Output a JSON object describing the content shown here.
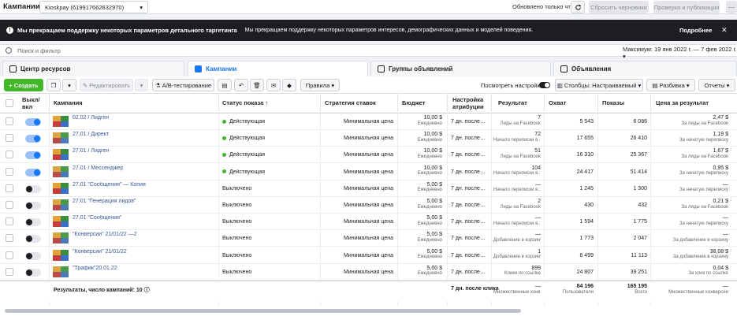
{
  "topbar": {
    "title": "Кампании",
    "account": "Kioskpay (619917662632970)",
    "updated": "Обновлено только что",
    "discard_label": "Сбросить черновики",
    "review_label": "Проверка и публикация"
  },
  "notice": {
    "title": "Мы прекращаем поддержку некоторых параметров детального таргетинга",
    "text": "Мы прекращаем поддержку некоторых параметров интересов, демографических данных и моделей поведения.",
    "more": "Подробнее"
  },
  "search": {
    "placeholder": "Поиск и фильтр",
    "daterange": "Максимум: 19 янв 2022 г. — 7 фев 2022 г."
  },
  "tabs": [
    "Центр ресурсов",
    "Кампании",
    "Группы объявлений",
    "Объявления"
  ],
  "toolbar": {
    "create": "+ Создать",
    "edit": "Редактировать",
    "ab": "A/B-тестирование",
    "rules": "Правила",
    "view_settings": "Посмотреть настройки",
    "columns": "Столбцы: Настраиваемый",
    "breakdown": "Разбивка",
    "reports": "Отчеты"
  },
  "headers": {
    "onoff": "Выкл/\nвкл",
    "campaign": "Кампания",
    "status": "Статус показа ↑",
    "strategy": "Стратегия ставок",
    "budget": "Бюджет",
    "attribution": "Настройка атрибуции",
    "result": "Результат",
    "reach": "Охват",
    "impressions": "Показы",
    "cpr": "Цена за результат"
  },
  "rows": [
    {
      "on": true,
      "name": "02.02 / Лидген",
      "status": "Действующая",
      "active": true,
      "strategy": "Минимальная цена",
      "budget": "10,00 $",
      "budget_sub": "Ежедневно",
      "attr": "7 дн. после клика",
      "result": "7",
      "result_sub": "Лиды на Facebook",
      "reach": "5 543",
      "impr": "6 086",
      "cpr": "2,47 $",
      "cpr_sub": "За лиды на Facebook"
    },
    {
      "on": true,
      "name": "27.01 / Директ",
      "status": "Действующая",
      "active": true,
      "strategy": "Минимальная цена",
      "budget": "10,00 $",
      "budget_sub": "Ежедневно",
      "attr": "7 дн. после клика",
      "result": "72",
      "result_sub": "Начало переписки в...",
      "reach": "17 655",
      "impr": "26 410",
      "cpr": "1,19 $",
      "cpr_sub": "За начатую переписку"
    },
    {
      "on": true,
      "name": "27.01 / Лидген",
      "status": "Действующая",
      "active": true,
      "strategy": "Минимальная цена",
      "budget": "10,00 $",
      "budget_sub": "Ежедневно",
      "attr": "7 дн. после клика",
      "result": "51",
      "result_sub": "Лиды на Facebook",
      "reach": "16 310",
      "impr": "25 367",
      "cpr": "1,67 $",
      "cpr_sub": "За лиды на Facebook"
    },
    {
      "on": true,
      "name": "27.01 / Мессенджер",
      "status": "Действующая",
      "active": true,
      "strategy": "Минимальная цена",
      "budget": "10,00 $",
      "budget_sub": "Ежедневно",
      "attr": "7 дн. после клика",
      "result": "104",
      "result_sub": "Начало переписки в...",
      "reach": "24 417",
      "impr": "51 414",
      "cpr": "0,95 $",
      "cpr_sub": "За начатую переписку"
    },
    {
      "on": false,
      "name": "27.01 \"Сообщения\" — Копия",
      "status": "Выключено",
      "active": false,
      "strategy": "Минимальная цена",
      "budget": "5,00 $",
      "budget_sub": "Ежедневно",
      "attr": "7 дн. после клика",
      "result": "—",
      "result_sub": "Начало переписки в...",
      "reach": "1 245",
      "impr": "1 300",
      "cpr": "—",
      "cpr_sub": "За начатую переписку"
    },
    {
      "on": false,
      "name": "27.01 \"Генерация лидов\"",
      "status": "Выключено",
      "active": false,
      "strategy": "Минимальная цена",
      "budget": "5,00 $",
      "budget_sub": "Ежедневно",
      "attr": "7 дн. после клика",
      "result": "2",
      "result_sub": "Лиды на Facebook",
      "reach": "430",
      "impr": "432",
      "cpr": "0,21 $",
      "cpr_sub": "За лиды на Facebook"
    },
    {
      "on": false,
      "name": "27.01 \"Сообщения\"",
      "status": "Выключено",
      "active": false,
      "strategy": "Минимальная цена",
      "budget": "5,00 $",
      "budget_sub": "Ежедневно",
      "attr": "7 дн. после клика",
      "result": "—",
      "result_sub": "Начало переписки в...",
      "reach": "1 594",
      "impr": "1 775",
      "cpr": "—",
      "cpr_sub": "За начатую переписку"
    },
    {
      "on": false,
      "name": "\"Конверсии\" 21/01/22 —2",
      "status": "Выключено",
      "active": false,
      "strategy": "Минимальная цена",
      "budget": "5,00 $",
      "budget_sub": "Ежедневно",
      "attr": "7 дн. после клика",
      "result": "—",
      "result_sub": "Добавление в корзину",
      "reach": "1 773",
      "impr": "2 047",
      "cpr": "—",
      "cpr_sub": "За добавление в корзину"
    },
    {
      "on": false,
      "name": "\"Конверсии\" 21/01/22",
      "status": "Выключено",
      "active": false,
      "strategy": "Минимальная цена",
      "budget": "5,00 $",
      "budget_sub": "Ежедневно",
      "attr": "7 дн. после клика",
      "result": "1",
      "result_sub": "Добавление в корзину",
      "reach": "6 499",
      "impr": "11 113",
      "cpr": "38,08 $",
      "cpr_sub": "За добавление в корзину"
    },
    {
      "on": false,
      "name": "\"Трафик\"20.01.22",
      "status": "Выключено",
      "active": false,
      "strategy": "Минимальная цена",
      "budget": "5,00 $",
      "budget_sub": "Ежедневно",
      "attr": "7 дн. после клика",
      "result": "899",
      "result_sub": "Клики по ссылке",
      "reach": "24 807",
      "impr": "39 251",
      "cpr": "0,04 $",
      "cpr_sub": "За клик по ссылке"
    }
  ],
  "totals": {
    "label": "Результаты, число кампаний: 10",
    "attr": "7 дн. после клика",
    "result": "—",
    "result_sub": "Множественные конв...",
    "reach": "84 196",
    "reach_sub": "Пользователи",
    "impr": "165 195",
    "impr_sub": "Всего",
    "cpr": "—",
    "cpr_sub": "Множественные конверсии"
  },
  "colors": {
    "accent": "#1877f2",
    "green": "#42b72a",
    "link": "#385898"
  }
}
